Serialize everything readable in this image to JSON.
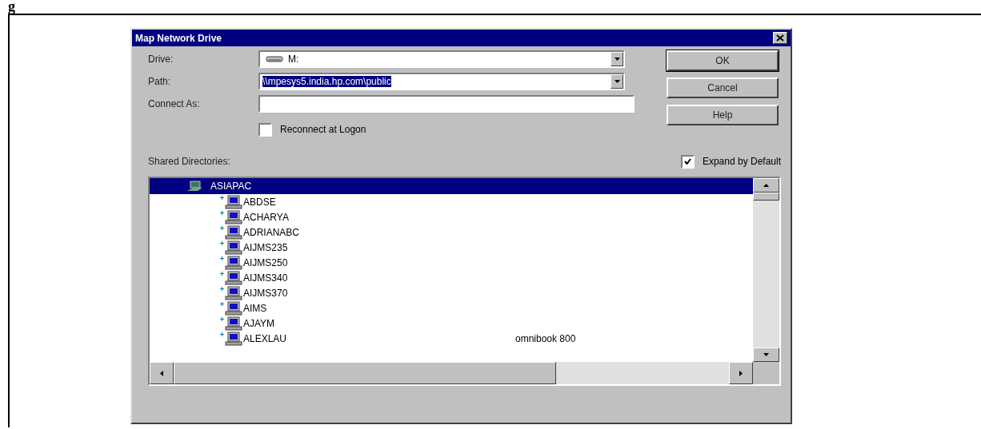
{
  "caption_fragment": "g",
  "window": {
    "title": "Map Network Drive"
  },
  "fields": [
    {
      "kind": "combo",
      "label": "Drive:",
      "value": "M:",
      "highlighted": false
    },
    {
      "kind": "combo",
      "label": "Path:",
      "value": "\\\\mpesys5.india.hp.com\\public",
      "highlighted": true
    },
    {
      "kind": "text",
      "label": "Connect As:"
    }
  ],
  "reconnect": {
    "label": "Reconnect at Logon",
    "checked": false
  },
  "buttons": [
    {
      "label": "OK",
      "default": true
    },
    {
      "label": "Cancel",
      "default": false
    },
    {
      "label": "Help",
      "default": false
    }
  ],
  "shared_label": "Shared Directories:",
  "expand": {
    "label": "Expand by Default",
    "checked": true
  },
  "tree": [
    {
      "label": "ASIAPAC",
      "selected": true,
      "children": [
        {
          "label": "ABDSE",
          "expanded": false
        },
        {
          "label": "ACHARYA",
          "expanded": false
        },
        {
          "label": "ADRIANABC",
          "expanded": false
        },
        {
          "label": "AIJMS235",
          "expanded": false
        },
        {
          "label": "AIJMS250",
          "expanded": false
        },
        {
          "label": "AIJMS340",
          "expanded": false
        },
        {
          "label": "AIJMS370",
          "expanded": false
        },
        {
          "label": "AIMS",
          "expanded": false
        },
        {
          "label": "AJAYM",
          "expanded": false
        },
        {
          "label": "ALEXLAU",
          "expanded": false,
          "comment": "omnibook 800"
        }
      ]
    }
  ]
}
